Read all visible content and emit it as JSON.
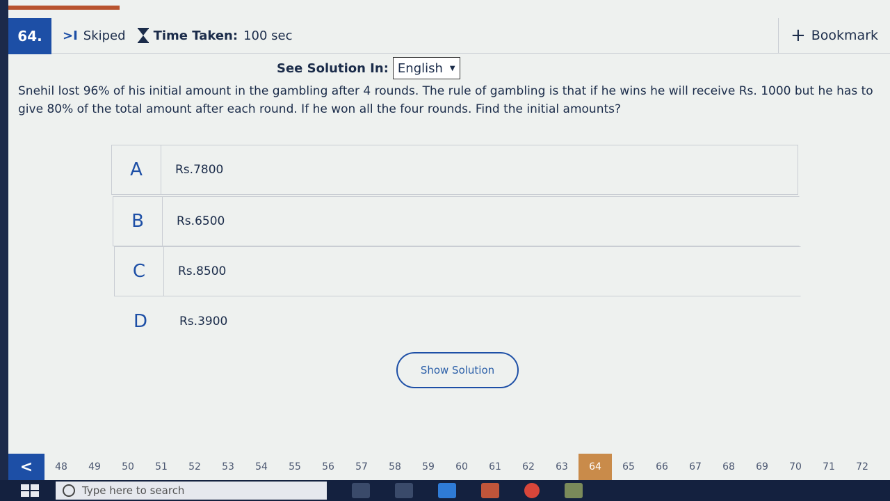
{
  "question_header": {
    "number": "64.",
    "skip_icon": ">I",
    "status": "Skiped",
    "time_label": "Time Taken:",
    "time_value": "100 sec",
    "bookmark_icon": "+",
    "bookmark_label": "Bookmark"
  },
  "solution_language": {
    "label": "See Solution In:",
    "selected": "English"
  },
  "question_text": "Snehil lost 96% of his initial amount in the gambling after 4 rounds. The rule of gambling is that if he wins he will receive Rs. 1000 but he has to give 80% of the total amount after each round. If he won all the four rounds. Find the initial amounts?",
  "options": [
    {
      "letter": "A",
      "text": "Rs.7800"
    },
    {
      "letter": "B",
      "text": "Rs.6500"
    },
    {
      "letter": "C",
      "text": "Rs.8500"
    },
    {
      "letter": "D",
      "text": "Rs.3900"
    }
  ],
  "show_solution_label": "Show Solution",
  "question_nav": {
    "prev_icon": "<",
    "numbers": [
      "48",
      "49",
      "50",
      "51",
      "52",
      "53",
      "54",
      "55",
      "56",
      "57",
      "58",
      "59",
      "60",
      "61",
      "62",
      "63",
      "64",
      "65",
      "66",
      "67",
      "68",
      "69",
      "70",
      "71",
      "72"
    ],
    "current": "64"
  },
  "taskbar": {
    "search_placeholder": "Type here to search"
  },
  "colors": {
    "accent": "#1d4fa6",
    "current_question": "#c98b4a",
    "taskbar": "#14213f"
  }
}
